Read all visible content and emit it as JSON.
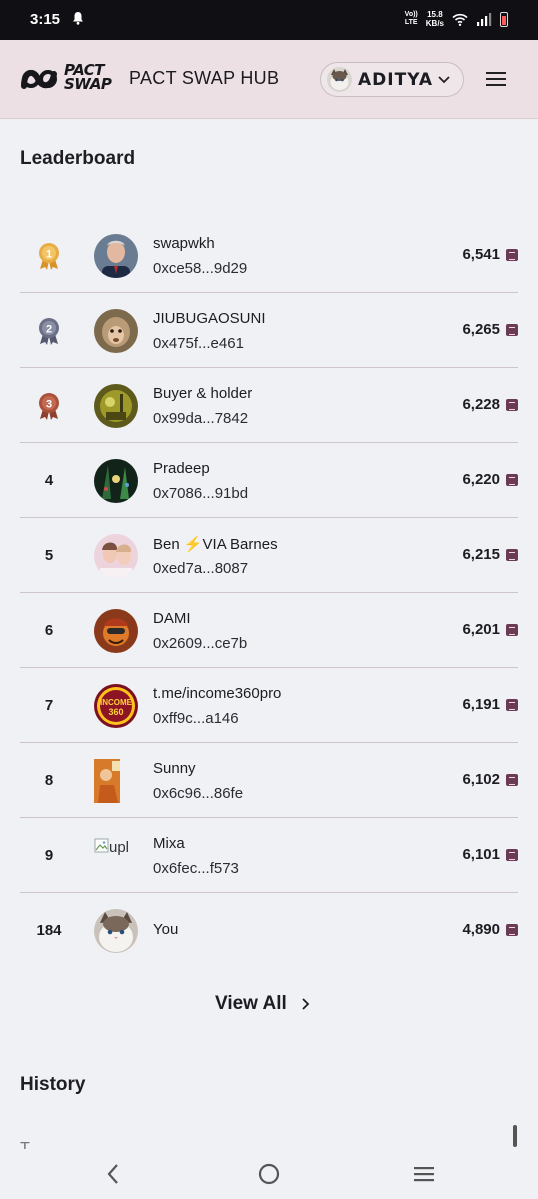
{
  "status_bar": {
    "time": "3:15",
    "network_top": "Vo))",
    "network_bottom": "LTE",
    "speed_value": "15.8",
    "speed_unit": "KB/s",
    "icons": [
      "notification-bell-icon",
      "wifi-icon",
      "signal-icon",
      "battery-icon"
    ]
  },
  "header": {
    "logo_line1": "PACT",
    "logo_line2": "SWAP",
    "title": "PACT SWAP HUB",
    "user_name": "ADITYA"
  },
  "leaderboard": {
    "title": "Leaderboard",
    "rows": [
      {
        "rank": "1",
        "medal": "gold",
        "name": "swapwkh",
        "address": "0xce58...9d29",
        "score": "6,541"
      },
      {
        "rank": "2",
        "medal": "silver",
        "name": "JIUBUGAOSUNI",
        "address": "0x475f...e461",
        "score": "6,265"
      },
      {
        "rank": "3",
        "medal": "bronze",
        "name": "Buyer & holder",
        "address": "0x99da...7842",
        "score": "6,228"
      },
      {
        "rank": "4",
        "medal": "",
        "name": "Pradeep",
        "address": "0x7086...91bd",
        "score": "6,220"
      },
      {
        "rank": "5",
        "medal": "",
        "name": "Ben ⚡VIA Barnes",
        "address": "0xed7a...8087",
        "score": "6,215"
      },
      {
        "rank": "6",
        "medal": "",
        "name": "DAMI",
        "address": "0x2609...ce7b",
        "score": "6,201"
      },
      {
        "rank": "7",
        "medal": "",
        "name": "t.me/income360pro",
        "address": "0xff9c...a146",
        "score": "6,191"
      },
      {
        "rank": "8",
        "medal": "",
        "name": "Sunny",
        "address": "0x6c96...86fe",
        "score": "6,102"
      },
      {
        "rank": "9",
        "medal": "",
        "name": "Mixa",
        "address": "0x6fec...f573",
        "score": "6,101",
        "broken_avatar_alt": "upl"
      },
      {
        "rank": "184",
        "medal": "",
        "name": "You",
        "address": "",
        "score": "4,890"
      }
    ],
    "avatar_badge_line1": "INCOME",
    "avatar_badge_line2": "360",
    "view_all_label": "View All"
  },
  "history": {
    "title": "History",
    "partial_text": "T..."
  },
  "colors": {
    "header_bg": "#ece0e4",
    "page_bg": "#f0f1f5",
    "token_badge": "#6b3b56",
    "gold": "#e2a63a",
    "silver": "#6a6f86",
    "bronze": "#a9513b"
  }
}
